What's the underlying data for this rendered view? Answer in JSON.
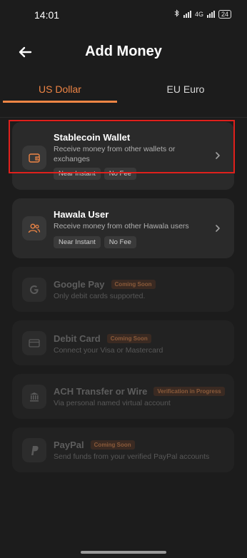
{
  "status_bar": {
    "time": "14:01",
    "network": "4G",
    "battery": "24"
  },
  "header": {
    "title": "Add Money"
  },
  "tabs": [
    {
      "label": "US Dollar",
      "active": true
    },
    {
      "label": "EU Euro",
      "active": false
    }
  ],
  "methods": [
    {
      "title": "Stablecoin Wallet",
      "description": "Receive money from other wallets or exchanges",
      "tags": [
        "Near Instant",
        "No Fee"
      ],
      "icon": "wallet-icon",
      "enabled": true
    },
    {
      "title": "Hawala User",
      "description": "Receive money from other Hawala users",
      "tags": [
        "Near Instant",
        "No Fee"
      ],
      "icon": "users-icon",
      "enabled": true
    },
    {
      "title": "Google Pay",
      "badge": "Coming Soon",
      "description": "Only debit cards supported.",
      "icon": "google-icon",
      "enabled": false
    },
    {
      "title": "Debit Card",
      "badge": "Coming Soon",
      "description": "Connect your Visa or Mastercard",
      "icon": "credit-card-icon",
      "enabled": false
    },
    {
      "title": "ACH Transfer or Wire",
      "badge": "Verification in Progress",
      "description": "Via personal named virtual account",
      "icon": "bank-icon",
      "enabled": false
    },
    {
      "title": "PayPal",
      "badge": "Coming Soon",
      "description": "Send funds from your verified PayPal accounts",
      "icon": "paypal-icon",
      "enabled": false
    }
  ],
  "colors": {
    "accent": "#ef8545",
    "background": "#1c1c1c",
    "card": "#2a2a2a",
    "highlight": "#e0201c"
  }
}
